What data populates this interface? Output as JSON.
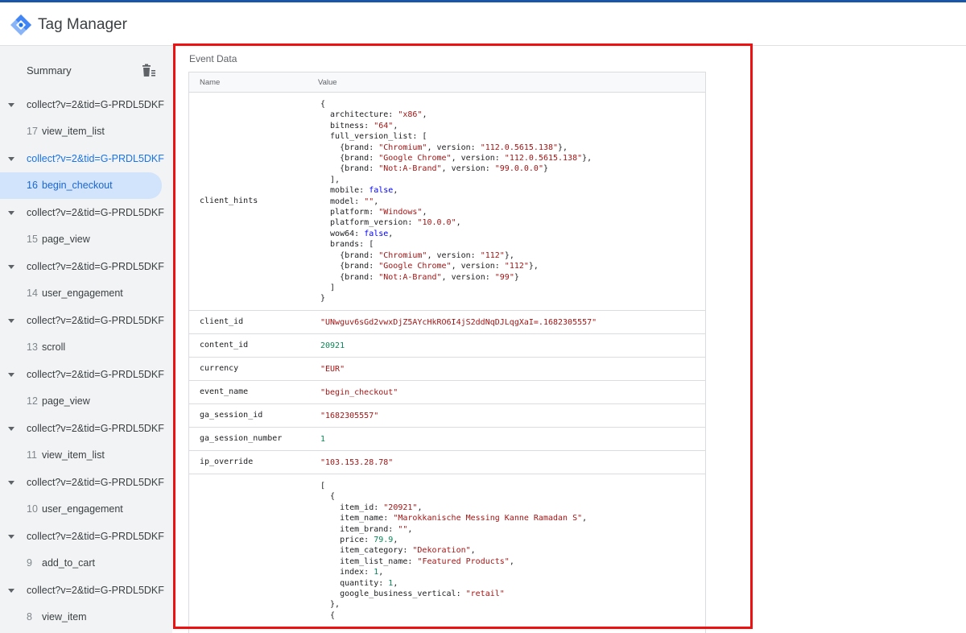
{
  "app": {
    "title": "Tag Manager"
  },
  "sidebar": {
    "summary_label": "Summary",
    "requests": [
      {
        "label": "collect?v=2&tid=G-PRDL5DKF",
        "event_num": "17",
        "event_label": "view_item_list",
        "active": false
      },
      {
        "label": "collect?v=2&tid=G-PRDL5DKF",
        "event_num": "16",
        "event_label": "begin_checkout",
        "active": true
      },
      {
        "label": "collect?v=2&tid=G-PRDL5DKF",
        "event_num": "15",
        "event_label": "page_view",
        "active": false
      },
      {
        "label": "collect?v=2&tid=G-PRDL5DKF",
        "event_num": "14",
        "event_label": "user_engagement",
        "active": false
      },
      {
        "label": "collect?v=2&tid=G-PRDL5DKF",
        "event_num": "13",
        "event_label": "scroll",
        "active": false
      },
      {
        "label": "collect?v=2&tid=G-PRDL5DKF",
        "event_num": "12",
        "event_label": "page_view",
        "active": false
      },
      {
        "label": "collect?v=2&tid=G-PRDL5DKF",
        "event_num": "11",
        "event_label": "view_item_list",
        "active": false
      },
      {
        "label": "collect?v=2&tid=G-PRDL5DKF",
        "event_num": "10",
        "event_label": "user_engagement",
        "active": false
      },
      {
        "label": "collect?v=2&tid=G-PRDL5DKF",
        "event_num": "9",
        "event_label": "add_to_cart",
        "active": false
      },
      {
        "label": "collect?v=2&tid=G-PRDL5DKF",
        "event_num": "8",
        "event_label": "view_item",
        "active": false
      }
    ]
  },
  "panel": {
    "title": "Event Data",
    "headers": {
      "name": "Name",
      "value": "Value"
    },
    "rows": [
      {
        "name": "client_hints",
        "lines": [
          [
            {
              "t": "{"
            }
          ],
          [
            {
              "t": "  architecture: "
            },
            {
              "t": "\"x86\"",
              "c": "str"
            },
            {
              "t": ","
            }
          ],
          [
            {
              "t": "  bitness: "
            },
            {
              "t": "\"64\"",
              "c": "str"
            },
            {
              "t": ","
            }
          ],
          [
            {
              "t": "  full_version_list: ["
            }
          ],
          [
            {
              "t": "    {brand: "
            },
            {
              "t": "\"Chromium\"",
              "c": "str"
            },
            {
              "t": ", version: "
            },
            {
              "t": "\"112.0.5615.138\"",
              "c": "str"
            },
            {
              "t": "},"
            }
          ],
          [
            {
              "t": "    {brand: "
            },
            {
              "t": "\"Google Chrome\"",
              "c": "str"
            },
            {
              "t": ", version: "
            },
            {
              "t": "\"112.0.5615.138\"",
              "c": "str"
            },
            {
              "t": "},"
            }
          ],
          [
            {
              "t": "    {brand: "
            },
            {
              "t": "\"Not:A-Brand\"",
              "c": "str"
            },
            {
              "t": ", version: "
            },
            {
              "t": "\"99.0.0.0\"",
              "c": "str"
            },
            {
              "t": "}"
            }
          ],
          [
            {
              "t": "  ],"
            }
          ],
          [
            {
              "t": "  mobile: "
            },
            {
              "t": "false",
              "c": "bool"
            },
            {
              "t": ","
            }
          ],
          [
            {
              "t": "  model: "
            },
            {
              "t": "\"\"",
              "c": "str"
            },
            {
              "t": ","
            }
          ],
          [
            {
              "t": "  platform: "
            },
            {
              "t": "\"Windows\"",
              "c": "str"
            },
            {
              "t": ","
            }
          ],
          [
            {
              "t": "  platform_version: "
            },
            {
              "t": "\"10.0.0\"",
              "c": "str"
            },
            {
              "t": ","
            }
          ],
          [
            {
              "t": "  wow64: "
            },
            {
              "t": "false",
              "c": "bool"
            },
            {
              "t": ","
            }
          ],
          [
            {
              "t": "  brands: ["
            }
          ],
          [
            {
              "t": "    {brand: "
            },
            {
              "t": "\"Chromium\"",
              "c": "str"
            },
            {
              "t": ", version: "
            },
            {
              "t": "\"112\"",
              "c": "str"
            },
            {
              "t": "},"
            }
          ],
          [
            {
              "t": "    {brand: "
            },
            {
              "t": "\"Google Chrome\"",
              "c": "str"
            },
            {
              "t": ", version: "
            },
            {
              "t": "\"112\"",
              "c": "str"
            },
            {
              "t": "},"
            }
          ],
          [
            {
              "t": "    {brand: "
            },
            {
              "t": "\"Not:A-Brand\"",
              "c": "str"
            },
            {
              "t": ", version: "
            },
            {
              "t": "\"99\"",
              "c": "str"
            },
            {
              "t": "}"
            }
          ],
          [
            {
              "t": "  ]"
            }
          ],
          [
            {
              "t": "}"
            }
          ]
        ]
      },
      {
        "name": "client_id",
        "lines": [
          [
            {
              "t": "\"UNwguv6sGd2vwxDjZ5AYcHkRO6I4jS2ddNqDJLqgXaI=.1682305557\"",
              "c": "str"
            }
          ]
        ]
      },
      {
        "name": "content_id",
        "lines": [
          [
            {
              "t": "20921",
              "c": "num"
            }
          ]
        ]
      },
      {
        "name": "currency",
        "lines": [
          [
            {
              "t": "\"EUR\"",
              "c": "str"
            }
          ]
        ]
      },
      {
        "name": "event_name",
        "lines": [
          [
            {
              "t": "\"begin_checkout\"",
              "c": "str"
            }
          ]
        ]
      },
      {
        "name": "ga_session_id",
        "lines": [
          [
            {
              "t": "\"1682305557\"",
              "c": "str"
            }
          ]
        ]
      },
      {
        "name": "ga_session_number",
        "lines": [
          [
            {
              "t": "1",
              "c": "num"
            }
          ]
        ]
      },
      {
        "name": "ip_override",
        "lines": [
          [
            {
              "t": "\"103.153.28.78\"",
              "c": "str"
            }
          ]
        ]
      },
      {
        "name": "",
        "lines": [
          [
            {
              "t": "["
            }
          ],
          [
            {
              "t": "  {"
            }
          ],
          [
            {
              "t": "    item_id: "
            },
            {
              "t": "\"20921\"",
              "c": "str"
            },
            {
              "t": ","
            }
          ],
          [
            {
              "t": "    item_name: "
            },
            {
              "t": "\"Marokkanische Messing Kanne Ramadan S\"",
              "c": "str"
            },
            {
              "t": ","
            }
          ],
          [
            {
              "t": "    item_brand: "
            },
            {
              "t": "\"\"",
              "c": "str"
            },
            {
              "t": ","
            }
          ],
          [
            {
              "t": "    price: "
            },
            {
              "t": "79.9",
              "c": "num"
            },
            {
              "t": ","
            }
          ],
          [
            {
              "t": "    item_category: "
            },
            {
              "t": "\"Dekoration\"",
              "c": "str"
            },
            {
              "t": ","
            }
          ],
          [
            {
              "t": "    item_list_name: "
            },
            {
              "t": "\"Featured Products\"",
              "c": "str"
            },
            {
              "t": ","
            }
          ],
          [
            {
              "t": "    index: "
            },
            {
              "t": "1",
              "c": "num"
            },
            {
              "t": ","
            }
          ],
          [
            {
              "t": "    quantity: "
            },
            {
              "t": "1",
              "c": "num"
            },
            {
              "t": ","
            }
          ],
          [
            {
              "t": "    google_business_vertical: "
            },
            {
              "t": "\"retail\"",
              "c": "str"
            }
          ],
          [
            {
              "t": "  },"
            }
          ],
          [
            {
              "t": "  {"
            }
          ]
        ]
      }
    ]
  }
}
